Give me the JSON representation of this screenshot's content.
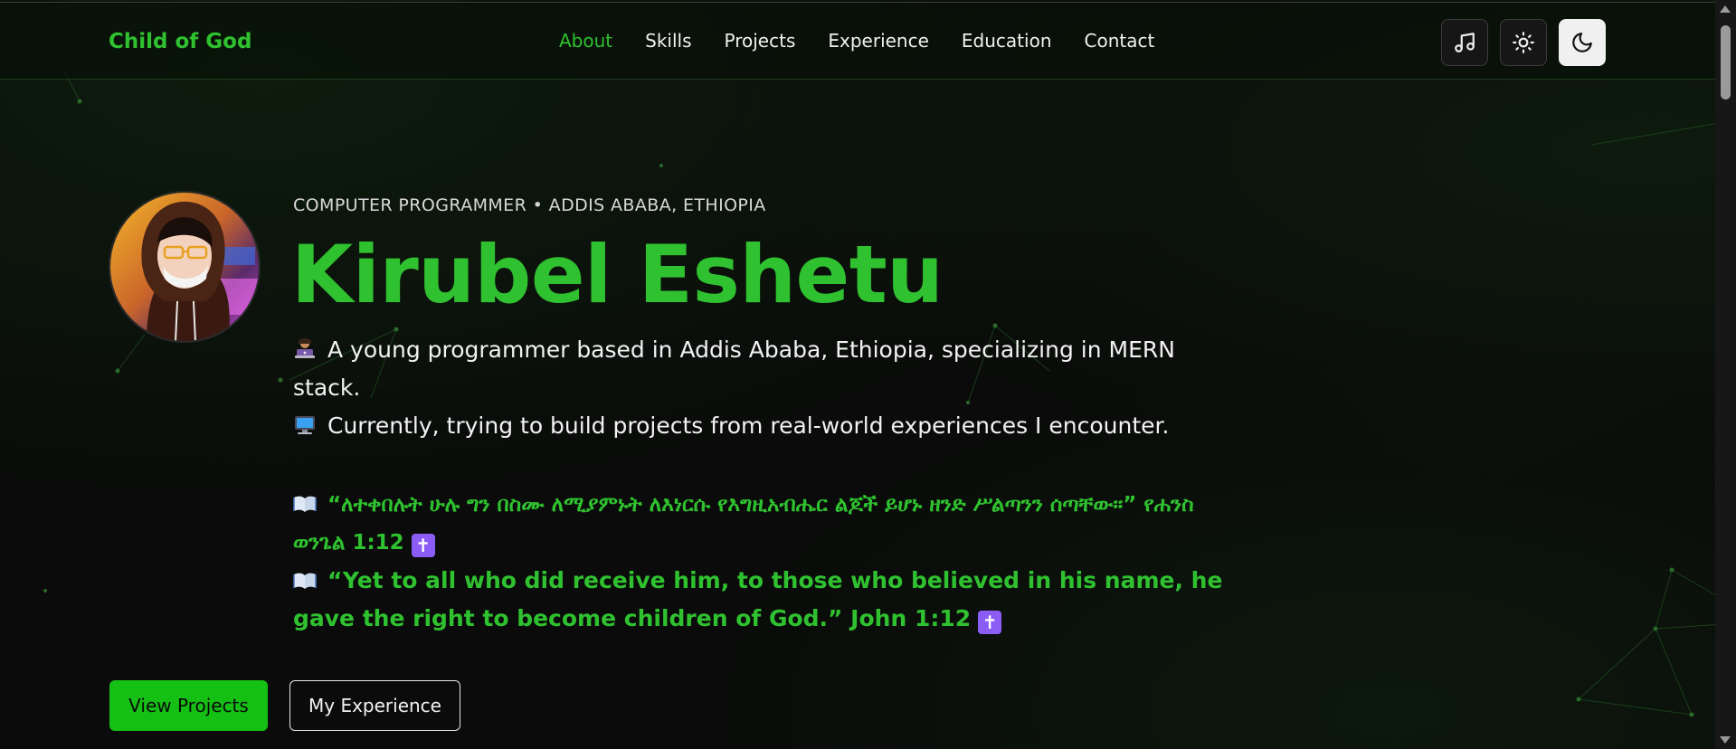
{
  "brand": "Child of God",
  "nav": {
    "links": [
      "About",
      "Skills",
      "Projects",
      "Experience",
      "Education",
      "Contact"
    ],
    "active": "About",
    "buttons": [
      {
        "icon": "music-note-icon"
      },
      {
        "icon": "sun-icon"
      },
      {
        "icon": "moon-icon"
      }
    ]
  },
  "hero": {
    "subtitle": "COMPUTER PROGRAMMER • ADDIS ABABA, ETHIOPIA",
    "name": "Kirubel Eshetu",
    "bio_line1": "A young programmer based in Addis Ababa, Ethiopia, specializing in MERN stack.",
    "bio_line2": "Currently, trying to build projects from real-world experiences I encounter.",
    "verse_amharic": "“ለተቀበሉት ሁሉ ግን በስሙ ለሚያምኑት ለእነርሱ የእግዚአብሔር ልጆች ይሆኑ ዘንድ ሥልጣንን ሰጣቸው።” የሐንስ ወንጌል 1:12",
    "verse_english": "“Yet to all who did receive him, to those who believed in his name, he gave the right to become children of God.” John 1:12",
    "cross_glyph": "✝"
  },
  "actions": {
    "primary": "View Projects",
    "secondary": "My Experience"
  },
  "colors": {
    "accent": "#2fc12f",
    "background": "#0a0b0a",
    "button_green": "#15c015"
  }
}
